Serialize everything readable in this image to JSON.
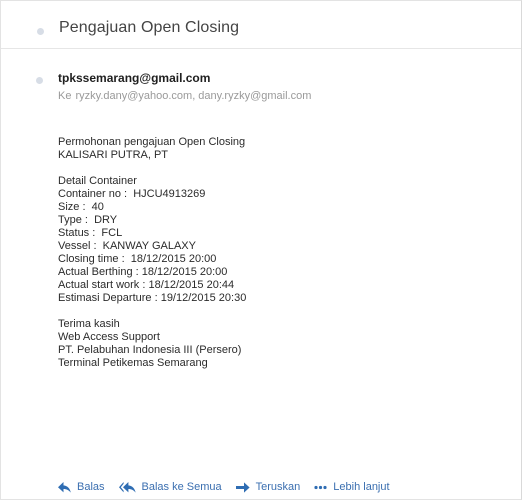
{
  "thread": {
    "subject": "Pengajuan Open Closing"
  },
  "message": {
    "from": "tpkssemarang@gmail.com",
    "to_prefix": "Ke",
    "to": "ryzky.dany@yahoo.com, dany.ryzky@gmail.com",
    "body_lines": [
      "Permohonan pengajuan Open Closing",
      "KALISARI PUTRA, PT",
      "",
      "Detail Container",
      "Container no :  HJCU4913269",
      "Size :  40",
      "Type :  DRY",
      "Status :  FCL",
      "Vessel :  KANWAY GALAXY",
      "Closing time :  18/12/2015 20:00",
      "Actual Berthing : 18/12/2015 20:00",
      "Actual start work : 18/12/2015 20:44",
      "Estimasi Departure : 19/12/2015 20:30",
      "",
      "Terima kasih",
      "Web Access Support",
      "PT. Pelabuhan Indonesia III (Persero)",
      "Terminal Petikemas Semarang"
    ]
  },
  "actions": {
    "reply": {
      "label": "Balas",
      "icon": "reply-icon"
    },
    "reply_all": {
      "label": "Balas ke Semua",
      "icon": "reply-all-icon"
    },
    "forward": {
      "label": "Teruskan",
      "icon": "forward-icon"
    },
    "more": {
      "label": "Lebih lanjut",
      "icon": "more-dots-icon"
    }
  },
  "colors": {
    "accent": "#2f6db3",
    "muted_text": "#9a9a9a",
    "dot": "#d7dde6"
  }
}
